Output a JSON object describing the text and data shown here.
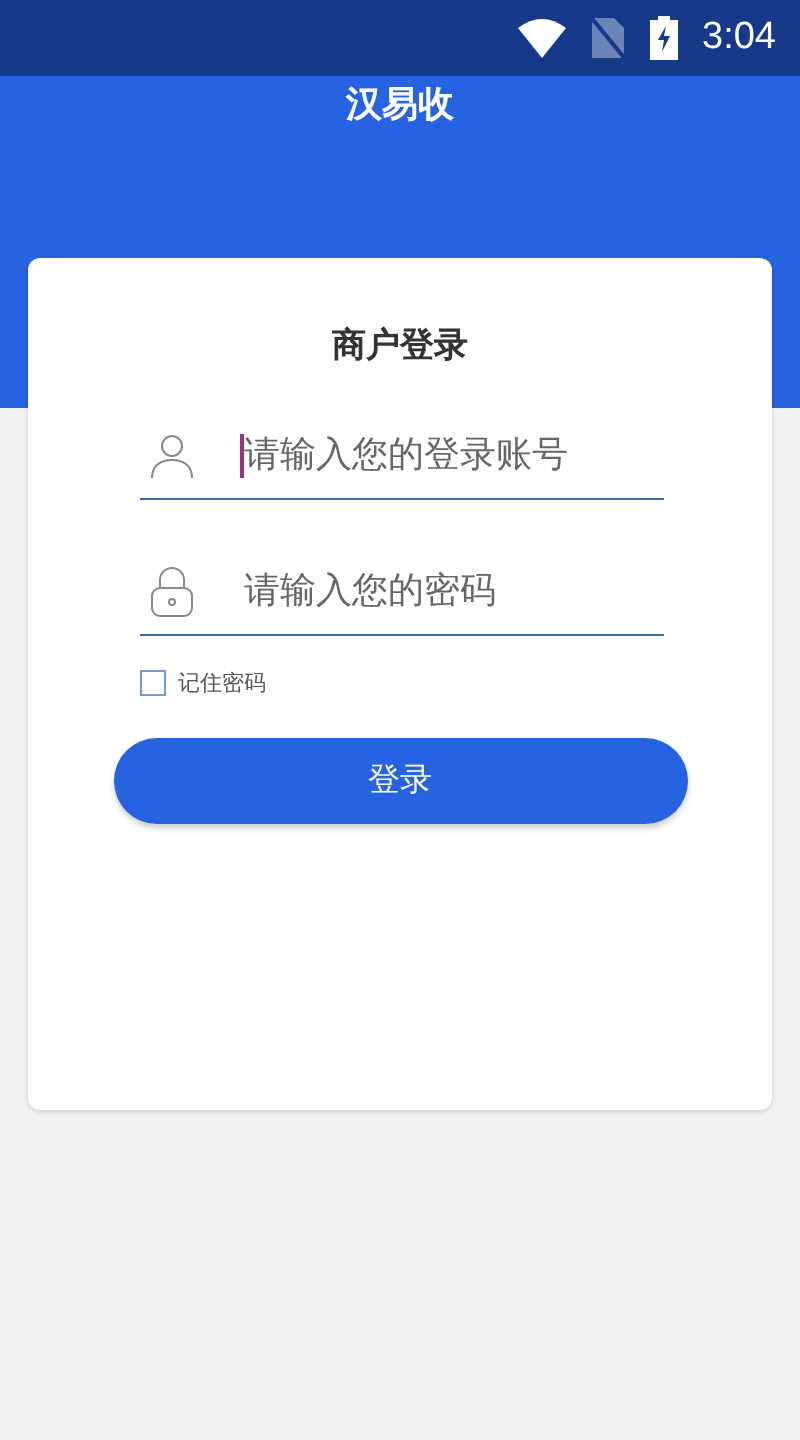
{
  "status_bar": {
    "time": "3:04"
  },
  "header": {
    "title": "汉易收"
  },
  "login": {
    "title": "商户登录",
    "fields": [
      {
        "kind": "account",
        "placeholder": "请输入您的登录账号",
        "focused": true
      },
      {
        "kind": "password",
        "placeholder": "请输入您的密码",
        "focused": false
      }
    ],
    "remember": {
      "label": "记住密码",
      "checked": false
    },
    "submit": "登录"
  }
}
